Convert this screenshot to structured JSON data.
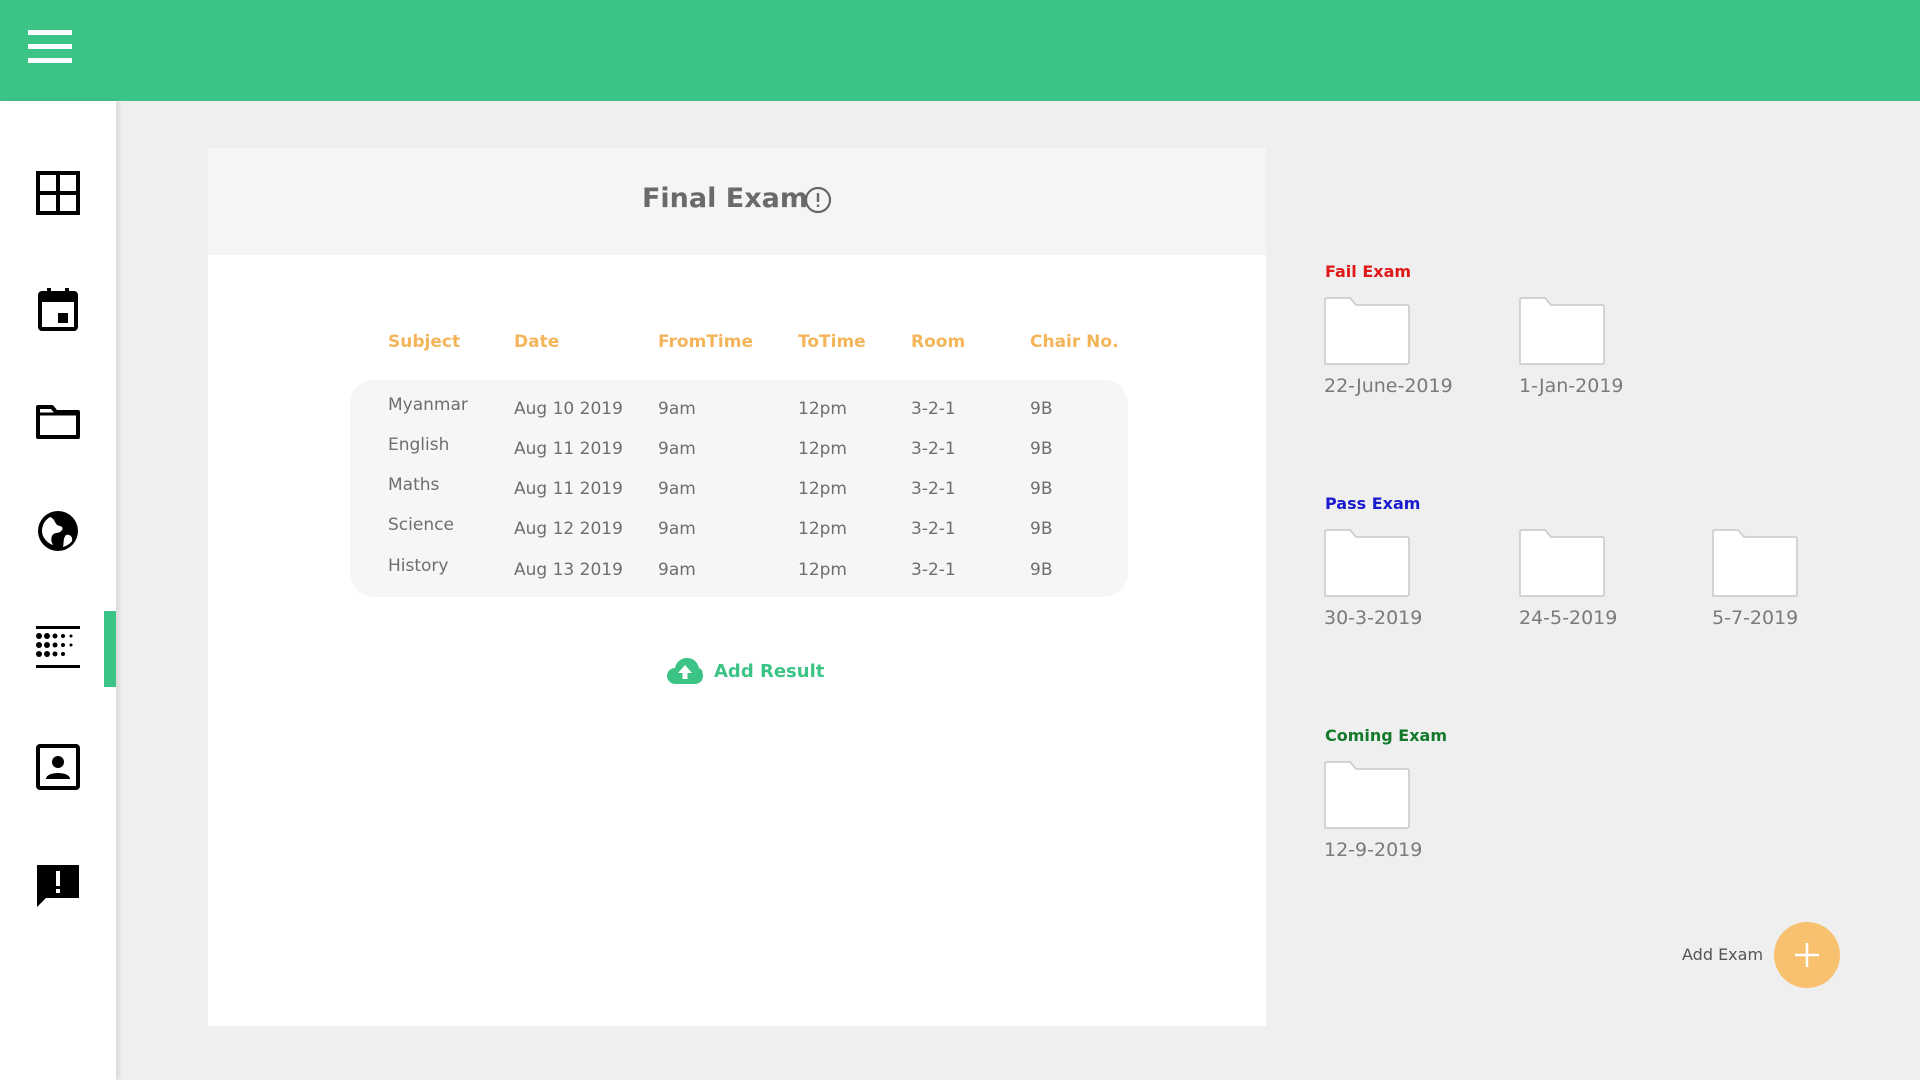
{
  "colors": {
    "primary": "#3cc486",
    "accent": "#f4b55a",
    "fail": "#e01818",
    "pass": "#1a1ad0",
    "coming": "#127a2a",
    "fab": "#f7c16f"
  },
  "topbar": {
    "menu_icon": "hamburger-menu-icon"
  },
  "sidebar": {
    "items": [
      {
        "icon": "dashboard-grid-icon"
      },
      {
        "icon": "calendar-icon"
      },
      {
        "icon": "folder-icon"
      },
      {
        "icon": "globe-icon"
      },
      {
        "icon": "exam-list-icon",
        "active": true
      },
      {
        "icon": "contact-card-icon"
      },
      {
        "icon": "feedback-alert-icon"
      }
    ]
  },
  "exam_card": {
    "title": "Final Exam",
    "headers": [
      "Subject",
      "Date",
      "FromTime",
      "ToTime",
      "Room",
      "Chair No."
    ],
    "rows": [
      [
        "Myanmar",
        "Aug 10 2019",
        "9am",
        "12pm",
        "3-2-1",
        "9B"
      ],
      [
        "English",
        "Aug 11 2019",
        "9am",
        "12pm",
        "3-2-1",
        "9B"
      ],
      [
        "Maths",
        "Aug 11 2019",
        "9am",
        "12pm",
        "3-2-1",
        "9B"
      ],
      [
        "Science",
        "Aug 12 2019",
        "9am",
        "12pm",
        "3-2-1",
        "9B"
      ],
      [
        "History",
        "Aug 13 2019",
        "9am",
        "12pm",
        "3-2-1",
        "9B"
      ]
    ],
    "add_result_label": "Add Result"
  },
  "sections": {
    "fail": {
      "label": "Fail Exam",
      "folders": [
        "22-June-2019",
        "1-Jan-2019"
      ]
    },
    "pass": {
      "label": "Pass Exam",
      "folders": [
        "30-3-2019",
        "24-5-2019",
        "5-7-2019"
      ]
    },
    "coming": {
      "label": "Coming Exam",
      "folders": [
        "12-9-2019"
      ]
    }
  },
  "add_exam_label": "Add Exam"
}
